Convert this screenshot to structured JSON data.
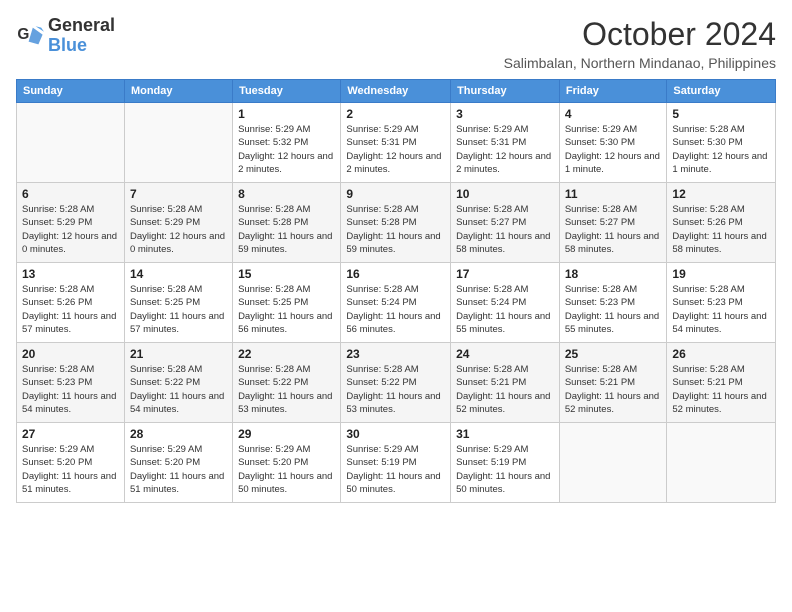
{
  "logo": {
    "line1": "General",
    "line2": "Blue"
  },
  "title": "October 2024",
  "subtitle": "Salimbalan, Northern Mindanao, Philippines",
  "weekdays": [
    "Sunday",
    "Monday",
    "Tuesday",
    "Wednesday",
    "Thursday",
    "Friday",
    "Saturday"
  ],
  "weeks": [
    [
      {
        "day": "",
        "info": ""
      },
      {
        "day": "",
        "info": ""
      },
      {
        "day": "1",
        "info": "Sunrise: 5:29 AM\nSunset: 5:32 PM\nDaylight: 12 hours and 2 minutes."
      },
      {
        "day": "2",
        "info": "Sunrise: 5:29 AM\nSunset: 5:31 PM\nDaylight: 12 hours and 2 minutes."
      },
      {
        "day": "3",
        "info": "Sunrise: 5:29 AM\nSunset: 5:31 PM\nDaylight: 12 hours and 2 minutes."
      },
      {
        "day": "4",
        "info": "Sunrise: 5:29 AM\nSunset: 5:30 PM\nDaylight: 12 hours and 1 minute."
      },
      {
        "day": "5",
        "info": "Sunrise: 5:28 AM\nSunset: 5:30 PM\nDaylight: 12 hours and 1 minute."
      }
    ],
    [
      {
        "day": "6",
        "info": "Sunrise: 5:28 AM\nSunset: 5:29 PM\nDaylight: 12 hours and 0 minutes."
      },
      {
        "day": "7",
        "info": "Sunrise: 5:28 AM\nSunset: 5:29 PM\nDaylight: 12 hours and 0 minutes."
      },
      {
        "day": "8",
        "info": "Sunrise: 5:28 AM\nSunset: 5:28 PM\nDaylight: 11 hours and 59 minutes."
      },
      {
        "day": "9",
        "info": "Sunrise: 5:28 AM\nSunset: 5:28 PM\nDaylight: 11 hours and 59 minutes."
      },
      {
        "day": "10",
        "info": "Sunrise: 5:28 AM\nSunset: 5:27 PM\nDaylight: 11 hours and 58 minutes."
      },
      {
        "day": "11",
        "info": "Sunrise: 5:28 AM\nSunset: 5:27 PM\nDaylight: 11 hours and 58 minutes."
      },
      {
        "day": "12",
        "info": "Sunrise: 5:28 AM\nSunset: 5:26 PM\nDaylight: 11 hours and 58 minutes."
      }
    ],
    [
      {
        "day": "13",
        "info": "Sunrise: 5:28 AM\nSunset: 5:26 PM\nDaylight: 11 hours and 57 minutes."
      },
      {
        "day": "14",
        "info": "Sunrise: 5:28 AM\nSunset: 5:25 PM\nDaylight: 11 hours and 57 minutes."
      },
      {
        "day": "15",
        "info": "Sunrise: 5:28 AM\nSunset: 5:25 PM\nDaylight: 11 hours and 56 minutes."
      },
      {
        "day": "16",
        "info": "Sunrise: 5:28 AM\nSunset: 5:24 PM\nDaylight: 11 hours and 56 minutes."
      },
      {
        "day": "17",
        "info": "Sunrise: 5:28 AM\nSunset: 5:24 PM\nDaylight: 11 hours and 55 minutes."
      },
      {
        "day": "18",
        "info": "Sunrise: 5:28 AM\nSunset: 5:23 PM\nDaylight: 11 hours and 55 minutes."
      },
      {
        "day": "19",
        "info": "Sunrise: 5:28 AM\nSunset: 5:23 PM\nDaylight: 11 hours and 54 minutes."
      }
    ],
    [
      {
        "day": "20",
        "info": "Sunrise: 5:28 AM\nSunset: 5:23 PM\nDaylight: 11 hours and 54 minutes."
      },
      {
        "day": "21",
        "info": "Sunrise: 5:28 AM\nSunset: 5:22 PM\nDaylight: 11 hours and 54 minutes."
      },
      {
        "day": "22",
        "info": "Sunrise: 5:28 AM\nSunset: 5:22 PM\nDaylight: 11 hours and 53 minutes."
      },
      {
        "day": "23",
        "info": "Sunrise: 5:28 AM\nSunset: 5:22 PM\nDaylight: 11 hours and 53 minutes."
      },
      {
        "day": "24",
        "info": "Sunrise: 5:28 AM\nSunset: 5:21 PM\nDaylight: 11 hours and 52 minutes."
      },
      {
        "day": "25",
        "info": "Sunrise: 5:28 AM\nSunset: 5:21 PM\nDaylight: 11 hours and 52 minutes."
      },
      {
        "day": "26",
        "info": "Sunrise: 5:28 AM\nSunset: 5:21 PM\nDaylight: 11 hours and 52 minutes."
      }
    ],
    [
      {
        "day": "27",
        "info": "Sunrise: 5:29 AM\nSunset: 5:20 PM\nDaylight: 11 hours and 51 minutes."
      },
      {
        "day": "28",
        "info": "Sunrise: 5:29 AM\nSunset: 5:20 PM\nDaylight: 11 hours and 51 minutes."
      },
      {
        "day": "29",
        "info": "Sunrise: 5:29 AM\nSunset: 5:20 PM\nDaylight: 11 hours and 50 minutes."
      },
      {
        "day": "30",
        "info": "Sunrise: 5:29 AM\nSunset: 5:19 PM\nDaylight: 11 hours and 50 minutes."
      },
      {
        "day": "31",
        "info": "Sunrise: 5:29 AM\nSunset: 5:19 PM\nDaylight: 11 hours and 50 minutes."
      },
      {
        "day": "",
        "info": ""
      },
      {
        "day": "",
        "info": ""
      }
    ]
  ]
}
